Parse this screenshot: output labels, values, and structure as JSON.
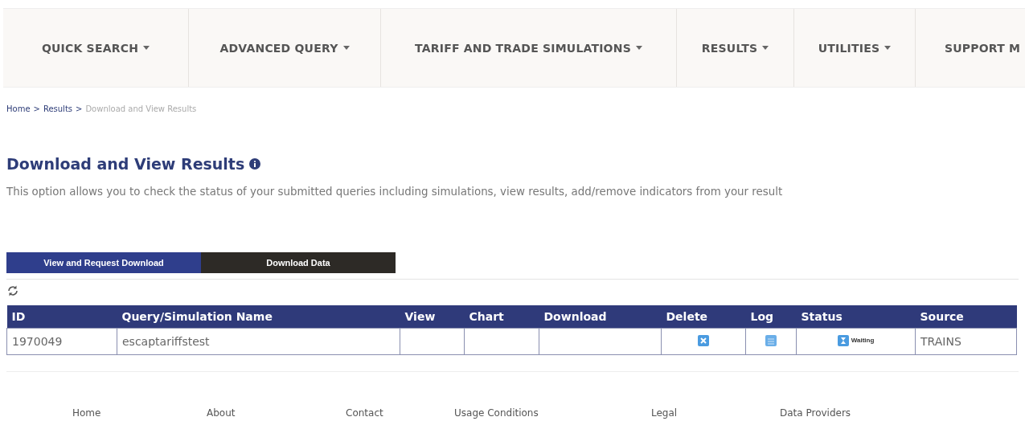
{
  "nav": {
    "items": [
      {
        "label": "QUICK SEARCH",
        "dropdown": true
      },
      {
        "label": "ADVANCED QUERY",
        "dropdown": true
      },
      {
        "label": "TARIFF AND TRADE SIMULATIONS",
        "dropdown": true
      },
      {
        "label": "RESULTS",
        "dropdown": true
      },
      {
        "label": "UTILITIES",
        "dropdown": true
      },
      {
        "label": "SUPPORT M"
      }
    ]
  },
  "breadcrumb": [
    {
      "label": "Home",
      "current": false
    },
    {
      "label": "Results",
      "current": false
    },
    {
      "label": "Download and View Results",
      "current": true
    }
  ],
  "breadcrumb_separator": ">",
  "page_title": "Download and View Results",
  "description": "This option allows you to check the status of your submitted queries including simulations, view results, add/remove indicators from your result",
  "tabs": [
    {
      "label": "View and Request Download",
      "selected": true
    },
    {
      "label": "Download Data",
      "selected": false
    }
  ],
  "table": {
    "columns": [
      "ID",
      "Query/Simulation Name",
      "View",
      "Chart",
      "Download",
      "Delete",
      "Log",
      "Status",
      "Source"
    ],
    "rows": [
      {
        "id": "1970049",
        "name": "escaptariffstest",
        "status": "Waiting",
        "source": "TRAINS"
      }
    ]
  },
  "footer": {
    "links": [
      "Home",
      "About",
      "Contact",
      "Usage Conditions",
      "Legal",
      "Data Providers"
    ]
  }
}
